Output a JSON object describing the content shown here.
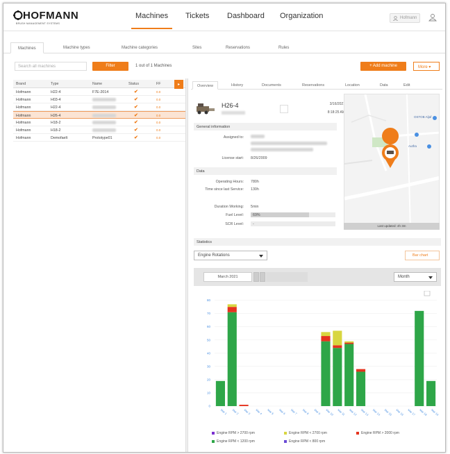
{
  "header": {
    "brand": "HOFMANN",
    "brand_sub": "BRUSH MANAGEMENT SYSTEMS",
    "nav": [
      "Machines",
      "Tickets",
      "Dashboard",
      "Organization"
    ],
    "user": "Hofmann"
  },
  "subtabs": [
    "Machines",
    "Machine types",
    "Machine categories",
    "Sites",
    "Reservations",
    "Rules"
  ],
  "toolbar": {
    "search_placeholder": "Search all machines",
    "filter_label": "Filter",
    "count": "1 out of 1 Machines",
    "add_label": "+ Add machine",
    "more_label": "More ▾"
  },
  "table": {
    "headers": [
      "Brand",
      "Type",
      "Name",
      "Status",
      "FF"
    ],
    "rows": [
      {
        "brand": "Hofmann",
        "type": "H22-4",
        "name": "F7E-2014",
        "ff": "0.0"
      },
      {
        "brand": "Hofmann",
        "type": "H03-4",
        "name": "",
        "ff": "0.0"
      },
      {
        "brand": "Hofmann",
        "type": "H22-4",
        "name": "",
        "ff": "0.0"
      },
      {
        "brand": "Hofmann",
        "type": "H26-4",
        "name": "",
        "ff": "0.0"
      },
      {
        "brand": "Hofmann",
        "type": "H18-2",
        "name": "",
        "ff": "0.0"
      },
      {
        "brand": "Hofmann",
        "type": "H18-2",
        "name": "",
        "ff": "0.0"
      },
      {
        "brand": "Hofmann",
        "type": "Demofaelt",
        "name": "Prototype01",
        "ff": "0.0"
      }
    ],
    "selected_index": 3
  },
  "detail": {
    "tabs": [
      "Overview",
      "History",
      "Documents",
      "Reservations",
      "Location",
      "Data",
      "Edit"
    ],
    "title": "H26-4",
    "date": "3/16/2021",
    "time": "8:18:25 AM",
    "section_general": "General information",
    "assigned_to_label": "Assigned to:",
    "license_start_label": "License start:",
    "license_start": "8/26/2009",
    "section_data": "Data",
    "data_fields": [
      {
        "label": "Operating Hours:",
        "value": "780h"
      },
      {
        "label": "Time since last Service:",
        "value": "130h"
      },
      {
        "label": "Duration Working:",
        "value": "5min"
      },
      {
        "label": "Fuel Level:",
        "value": "69%",
        "fill": 0.69
      },
      {
        "label": "SCR Level:",
        "value": "-",
        "fill": 0.0
      }
    ],
    "map_labels": [
      "OSTOB Aljaf",
      "Autfra"
    ],
    "map_footer": "Last updated: 4h 3m"
  },
  "statistics": {
    "header": "Statistics",
    "selector": "Engine Rotations",
    "bar_chart_btn": "Bar chart",
    "month": "March 2021",
    "period": "Month",
    "legend": [
      {
        "label": "Engine RPM > 2700 rpm",
        "color": "#7b2fd0"
      },
      {
        "label": "Engine RPM < 2700 rpm",
        "color": "#d8d640"
      },
      {
        "label": "Engine RPM > 2000 rpm",
        "color": "#e5331e"
      },
      {
        "label": "Engine RPM < 1200 rpm",
        "color": "#2ea648"
      },
      {
        "label": "Engine RPM < 800 rpm",
        "color": "#6a4bd6"
      }
    ]
  },
  "chart_data": {
    "type": "bar",
    "stacked": true,
    "yticks": [
      "80",
      "70",
      "60",
      "50",
      "40",
      "30",
      "20",
      "10",
      "0"
    ],
    "ylim": [
      0,
      84
    ],
    "categories": [
      "Mar 1",
      "Mar 2",
      "Mar 3",
      "Mar 4",
      "Mar 5",
      "Mar 6",
      "Mar 7",
      "Mar 8",
      "Mar 9",
      "Mar 10",
      "Mar 11",
      "Mar 12",
      "Mar 13",
      "Mar 14",
      "Mar 15",
      "Mar 16",
      "Mar 17",
      "Mar 18",
      "Mar 19"
    ],
    "series": [
      {
        "name": "Engine RPM < 1200 rpm",
        "color": "#2ea648",
        "values": [
          19,
          71,
          0,
          0,
          0,
          0,
          0,
          0,
          0,
          49,
          44,
          47,
          26,
          0,
          0,
          0,
          0,
          72,
          19
        ]
      },
      {
        "name": "Engine RPM > 2000 rpm",
        "color": "#e5331e",
        "values": [
          0,
          4,
          1,
          0,
          0,
          0,
          0,
          0,
          0,
          4,
          2,
          1,
          2,
          0,
          0,
          0,
          0,
          0,
          0
        ]
      },
      {
        "name": "Engine RPM < 2700 rpm",
        "color": "#d8d640",
        "values": [
          0,
          2,
          0,
          0,
          0,
          0,
          0,
          0,
          0,
          3,
          11,
          1,
          0,
          0,
          0,
          0,
          0,
          0,
          0
        ]
      }
    ]
  }
}
